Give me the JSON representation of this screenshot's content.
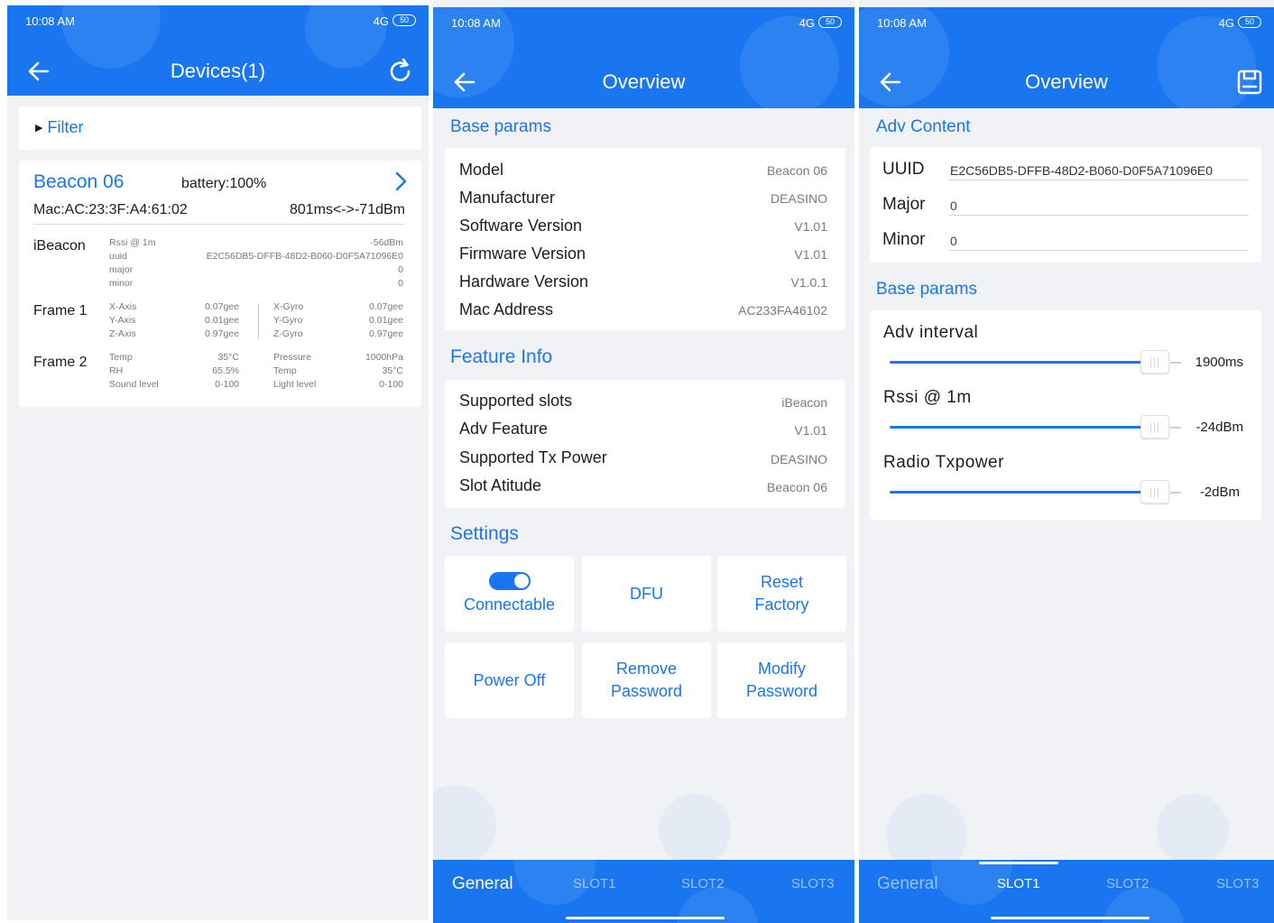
{
  "status": {
    "time": "10:08 AM",
    "network": "4G",
    "battery": "50"
  },
  "devices": {
    "title": "Devices(1)",
    "filter_label": "Filter",
    "device": {
      "name": "Beacon 06",
      "battery": "battery:100%",
      "mac": "Mac:AC:23:3F:A4:61:02",
      "interval_rssi": "801ms<->-71dBm",
      "ibeacon": {
        "title": "iBeacon",
        "labels": [
          "Rssi @ 1m",
          "uuid",
          "major",
          "minor"
        ],
        "values": [
          "-56dBm",
          "E2C56DB5-DFFB-48D2-B060-D0F5A71096E0",
          "0",
          "0"
        ]
      },
      "frame1": {
        "title": "Frame 1",
        "left_labels": [
          "X-Axis",
          "Y-Axis",
          "Z-Axis"
        ],
        "left_values": [
          "0.07gee",
          "0.01gee",
          "0.97gee"
        ],
        "right_labels": [
          "X-Gyro",
          "Y-Gyro",
          "Z-Gyro"
        ],
        "right_values": [
          "0.07gee",
          "0.01gee",
          "0.97gee"
        ]
      },
      "frame2": {
        "title": "Frame 2",
        "left_labels": [
          "Temp",
          "RH",
          "Sound level"
        ],
        "left_values": [
          "35°C",
          "65.5%",
          "0-100"
        ],
        "right_labels": [
          "Pressure",
          "Temp",
          "Light level"
        ],
        "right_values": [
          "1000hPa",
          "35°C",
          "0-100"
        ]
      }
    }
  },
  "overview": {
    "title": "Overview",
    "base_params_title": "Base params",
    "base_params": [
      {
        "label": "Model",
        "value": "Beacon 06"
      },
      {
        "label": "Manufacturer",
        "value": "DEASINO"
      },
      {
        "label": "Software Version",
        "value": "V1.01"
      },
      {
        "label": "Firmware Version",
        "value": "V1.01"
      },
      {
        "label": "Hardware Version",
        "value": "V1.0.1"
      },
      {
        "label": "Mac Address",
        "value": "AC233FA46102"
      }
    ],
    "feature_info_title": "Feature Info",
    "feature_info": [
      {
        "label": "Supported slots",
        "value": "iBeacon"
      },
      {
        "label": "Adv Feature",
        "value": "V1.01"
      },
      {
        "label": "Supported Tx Power",
        "value": "DEASINO"
      },
      {
        "label": "Slot Atitude",
        "value": "Beacon 06"
      }
    ],
    "settings_title": "Settings",
    "settings": {
      "connectable": "Connectable",
      "connectable_on": true,
      "dfu": "DFU",
      "reset_1": "Reset",
      "reset_2": "Factory",
      "power_off": "Power Off",
      "remove_1": "Remove",
      "remove_2": "Password",
      "modify_1": "Modify",
      "modify_2": "Password"
    },
    "tabs": [
      "General",
      "SLOT1",
      "SLOT2",
      "SLOT3"
    ],
    "active_tab": "General"
  },
  "slot": {
    "title": "Overview",
    "adv_content_title": "Adv Content",
    "uuid_label": "UUID",
    "uuid_value": "E2C56DB5-DFFB-48D2-B060-D0F5A71096E0",
    "major_label": "Major",
    "major_value": "0",
    "minor_label": "Minor",
    "minor_value": "0",
    "base_params_title": "Base params",
    "adv_interval_label": "Adv interval",
    "adv_interval_value": "1900ms",
    "rssi_label": "Rssi @ 1m",
    "rssi_value": "-24dBm",
    "txpower_label": "Radio Txpower",
    "txpower_value": "-2dBm",
    "tabs": [
      "General",
      "SLOT1",
      "SLOT2",
      "SLOT3"
    ],
    "active_tab": "SLOT1"
  },
  "colors": {
    "primary": "#1976f0",
    "background": "#f1f2f6"
  },
  "icons": [
    "back-arrow-icon",
    "refresh-icon",
    "save-icon",
    "chevron-right-icon",
    "filter-triangle-icon"
  ]
}
